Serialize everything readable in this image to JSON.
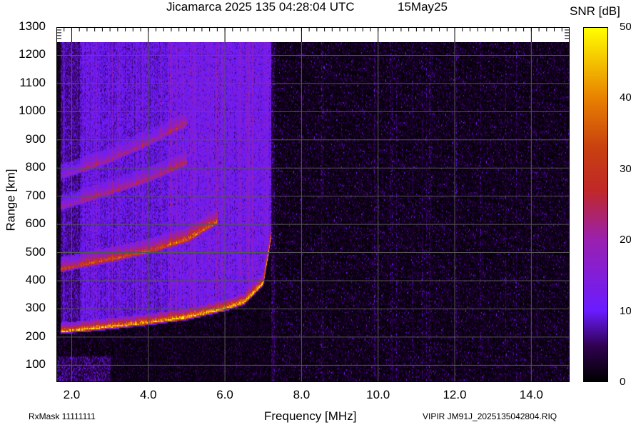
{
  "header": {
    "title": "Jicamarca 2025 135 04:28:04 UTC",
    "date": "15May25"
  },
  "footer": {
    "rx_mask": "RxMask 11111111",
    "file_name": "VIPIR  JM91J_2025135042804.RIQ"
  },
  "colors": {
    "background": "#000000",
    "grid": "#555555"
  },
  "chart_data": {
    "type": "heatmap",
    "title": "Jicamarca 2025 135 04:28:04 UTC",
    "xlabel": "Frequency [MHz]",
    "ylabel": "Range [km]",
    "xlim": [
      1.6,
      15.0
    ],
    "ylim": [
      40,
      1300
    ],
    "data_top_range": 1250,
    "xticks": [
      "2.0",
      "4.0",
      "6.0",
      "8.0",
      "10.0",
      "12.0",
      "14.0"
    ],
    "xtick_values": [
      2,
      4,
      6,
      8,
      10,
      12,
      14
    ],
    "yticks": [
      "100",
      "200",
      "300",
      "400",
      "500",
      "600",
      "700",
      "800",
      "900",
      "1000",
      "1100",
      "1200",
      "1300"
    ],
    "ytick_values": [
      100,
      200,
      300,
      400,
      500,
      600,
      700,
      800,
      900,
      1000,
      1100,
      1200,
      1300
    ],
    "grid": true,
    "colorbar": {
      "label": "SNR [dB]",
      "range": [
        0,
        50
      ],
      "ticks": [
        "0",
        "10",
        "20",
        "30",
        "40",
        "50"
      ],
      "tick_values": [
        0,
        10,
        20,
        30,
        40,
        50
      ],
      "stops": [
        [
          0,
          "#000000"
        ],
        [
          5,
          "#300050"
        ],
        [
          10,
          "#6a1cff"
        ],
        [
          20,
          "#9a20b0"
        ],
        [
          27,
          "#c02828"
        ],
        [
          33,
          "#c84010"
        ],
        [
          40,
          "#e88000"
        ],
        [
          50,
          "#ffff00"
        ]
      ]
    },
    "traces": [
      {
        "name": "F-layer O trace (1 hop)",
        "points": [
          [
            1.7,
            218
          ],
          [
            3.0,
            235
          ],
          [
            4.0,
            250
          ],
          [
            5.0,
            268
          ],
          [
            6.0,
            300
          ],
          [
            6.5,
            322
          ],
          [
            7.0,
            390
          ],
          [
            7.2,
            550
          ]
        ],
        "peak_snr": 42
      },
      {
        "name": "2-hop echo",
        "points": [
          [
            1.7,
            440
          ],
          [
            3.0,
            475
          ],
          [
            4.0,
            505
          ],
          [
            5.0,
            545
          ],
          [
            5.8,
            610
          ]
        ],
        "peak_snr": 28
      },
      {
        "name": "3-hop echo",
        "points": [
          [
            1.7,
            660
          ],
          [
            3.0,
            715
          ],
          [
            4.0,
            760
          ],
          [
            5.0,
            820
          ]
        ],
        "peak_snr": 16
      },
      {
        "name": "4-hop echo",
        "points": [
          [
            1.7,
            770
          ],
          [
            3.0,
            830
          ],
          [
            4.0,
            890
          ],
          [
            5.0,
            960
          ]
        ],
        "peak_snr": 14
      }
    ],
    "critical_frequency_mhz": 7.3
  }
}
